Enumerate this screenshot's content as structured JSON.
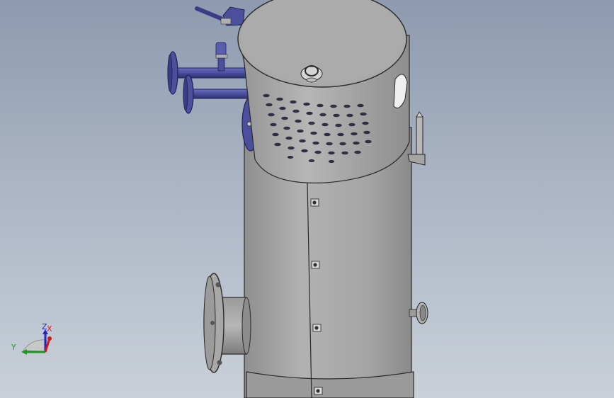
{
  "viewport": {
    "background_top": "#8d9aaf",
    "background_bottom": "#c9d0d9"
  },
  "model": {
    "shell_color": "#a3a3a3",
    "shell_shadow": "#6f6f6f",
    "fitting_color": "#4b4f9c",
    "fitting_dark": "#2d3070"
  },
  "triad": {
    "x_label": "X",
    "y_label": "Y",
    "z_label": "Z",
    "x_color": "#d11b1b",
    "y_color": "#1a9a1a",
    "z_color": "#2424c8"
  }
}
